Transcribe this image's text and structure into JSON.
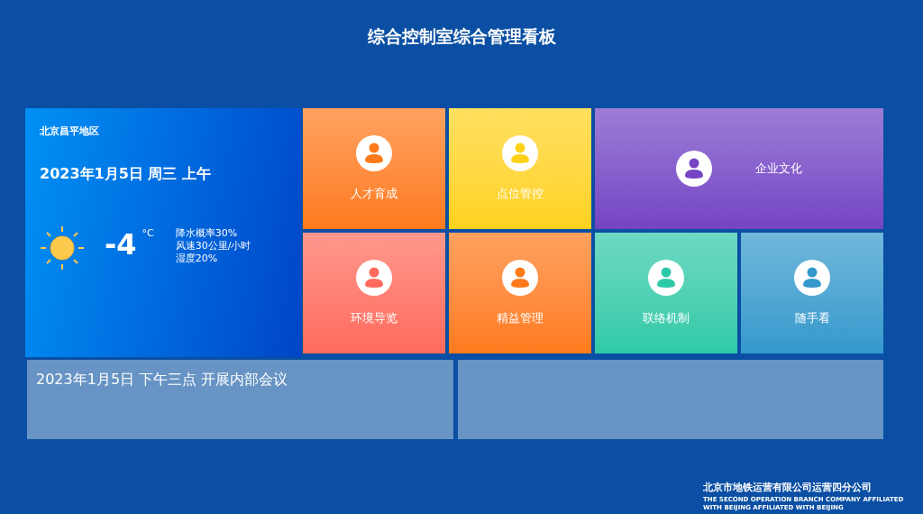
{
  "title": "综合控制室综合管理看板",
  "weather": {
    "region": "北京昌平地区",
    "date": "2023年1月5日 周三 上午",
    "temperature": "-4",
    "unit": "°C",
    "details": [
      "降水概率30%",
      "风速30公里/小时",
      "湿度20%"
    ]
  },
  "tiles": [
    {
      "label": "人才育成",
      "kind": "tall",
      "color": "#ff7a1a"
    },
    {
      "label": "点位管控",
      "kind": "tall",
      "color": "#ffd21a"
    },
    {
      "label": "企业文化",
      "kind": "wide",
      "color": "#7444c4"
    },
    {
      "label": "环境导览",
      "kind": "tall",
      "color": "#ff6a5c"
    },
    {
      "label": "精益管理",
      "kind": "tall",
      "color": "#ff7a1a"
    },
    {
      "label": "联络机制",
      "kind": "tall",
      "color": "#2ec9a8"
    },
    {
      "label": "随手看",
      "kind": "tall",
      "color": "#3399cc"
    }
  ],
  "notices": [
    {
      "kind": "text",
      "text": "2023年1月5日 下午三点 开展内部会议"
    },
    {
      "kind": "empty"
    }
  ],
  "footer": {
    "company": "北京市地铁运营有限公司运营四分公司",
    "english": "THE SECOND OPERATION BRANCH COMPANY AFFILIATED WITH BEIJING AFFILIATED WITH BEIJING"
  }
}
